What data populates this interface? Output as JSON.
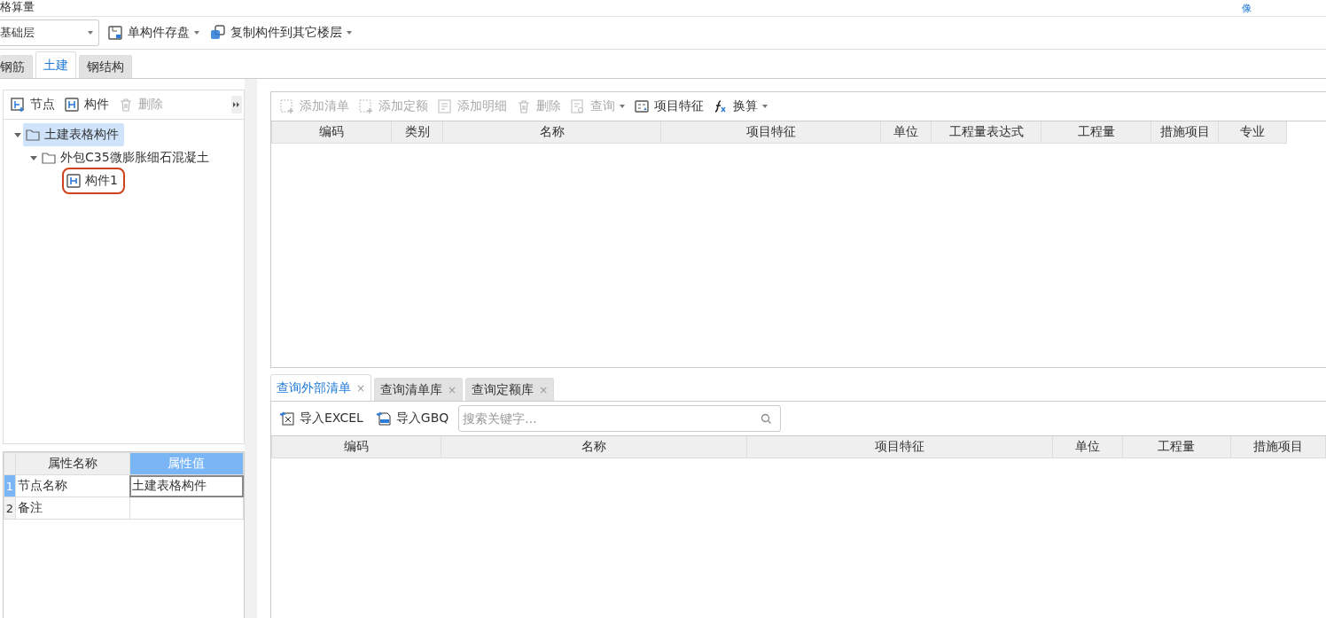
{
  "window": {
    "title": "格算量",
    "corner_text": "像"
  },
  "toolbar": {
    "floor_select": "基础层",
    "buttons": [
      {
        "label": "单构件存盘",
        "kind": "save",
        "dropdown": true
      },
      {
        "label": "复制构件到其它楼层",
        "kind": "copy",
        "dropdown": true
      }
    ]
  },
  "tabs": [
    {
      "label": "钢筋",
      "selected": false
    },
    {
      "label": "土建",
      "selected": true
    },
    {
      "label": "钢结构",
      "selected": false
    }
  ],
  "tree_toolbar": {
    "buttons": [
      {
        "label": "节点",
        "kind": "node",
        "disabled": false
      },
      {
        "label": "构件",
        "kind": "component",
        "disabled": false
      },
      {
        "label": "删除",
        "kind": "trash",
        "disabled": true
      }
    ]
  },
  "tree": [
    {
      "label": "土建表格构件",
      "kind": "folder",
      "selected": true,
      "expanded": true,
      "children": [
        {
          "label": "外包C35微膨胀细石混凝土",
          "kind": "folder",
          "selected": false,
          "expanded": true,
          "children": [
            {
              "label": "构件1",
              "kind": "part",
              "selected": false,
              "highlighted": true
            }
          ]
        }
      ]
    }
  ],
  "properties": {
    "columns": [
      "属性名称",
      "属性值"
    ],
    "rows": [
      {
        "index": "1",
        "name": "节点名称",
        "value": "土建表格构件",
        "selected": true
      },
      {
        "index": "2",
        "name": "备注",
        "selected": false
      }
    ]
  },
  "list_toolbar": {
    "buttons": [
      {
        "label": "添加清单",
        "kind": "add",
        "disabled": true,
        "dropdown": false
      },
      {
        "label": "添加定额",
        "kind": "add",
        "disabled": true,
        "dropdown": false
      },
      {
        "label": "添加明细",
        "kind": "detail",
        "disabled": true,
        "dropdown": false
      },
      {
        "label": "删除",
        "kind": "trash",
        "disabled": true,
        "dropdown": false
      },
      {
        "label": "查询",
        "kind": "query",
        "disabled": true,
        "dropdown": true
      },
      {
        "label": "项目特征",
        "kind": "feature",
        "disabled": false,
        "dropdown": false
      },
      {
        "label": "换算",
        "kind": "fx",
        "disabled": false,
        "dropdown": true
      }
    ]
  },
  "list_table": {
    "columns": [
      "编码",
      "类别",
      "名称",
      "项目特征",
      "单位",
      "工程量表达式",
      "工程量",
      "措施项目",
      "专业"
    ]
  },
  "query_tabs": [
    {
      "label": "查询外部清单",
      "close": "×",
      "selected": true
    },
    {
      "label": "查询清单库",
      "close": "×",
      "selected": false
    },
    {
      "label": "查询定额库",
      "close": "×",
      "selected": false
    }
  ],
  "query_toolbar": {
    "buttons": [
      {
        "label": "导入EXCEL",
        "kind": "excel"
      },
      {
        "label": "导入GBQ",
        "kind": "gbq"
      }
    ],
    "search": {
      "placeholder": "搜索关键字..."
    }
  },
  "query_table": {
    "columns": [
      "编码",
      "名称",
      "项目特征",
      "单位",
      "工程量",
      "措施项目"
    ]
  }
}
